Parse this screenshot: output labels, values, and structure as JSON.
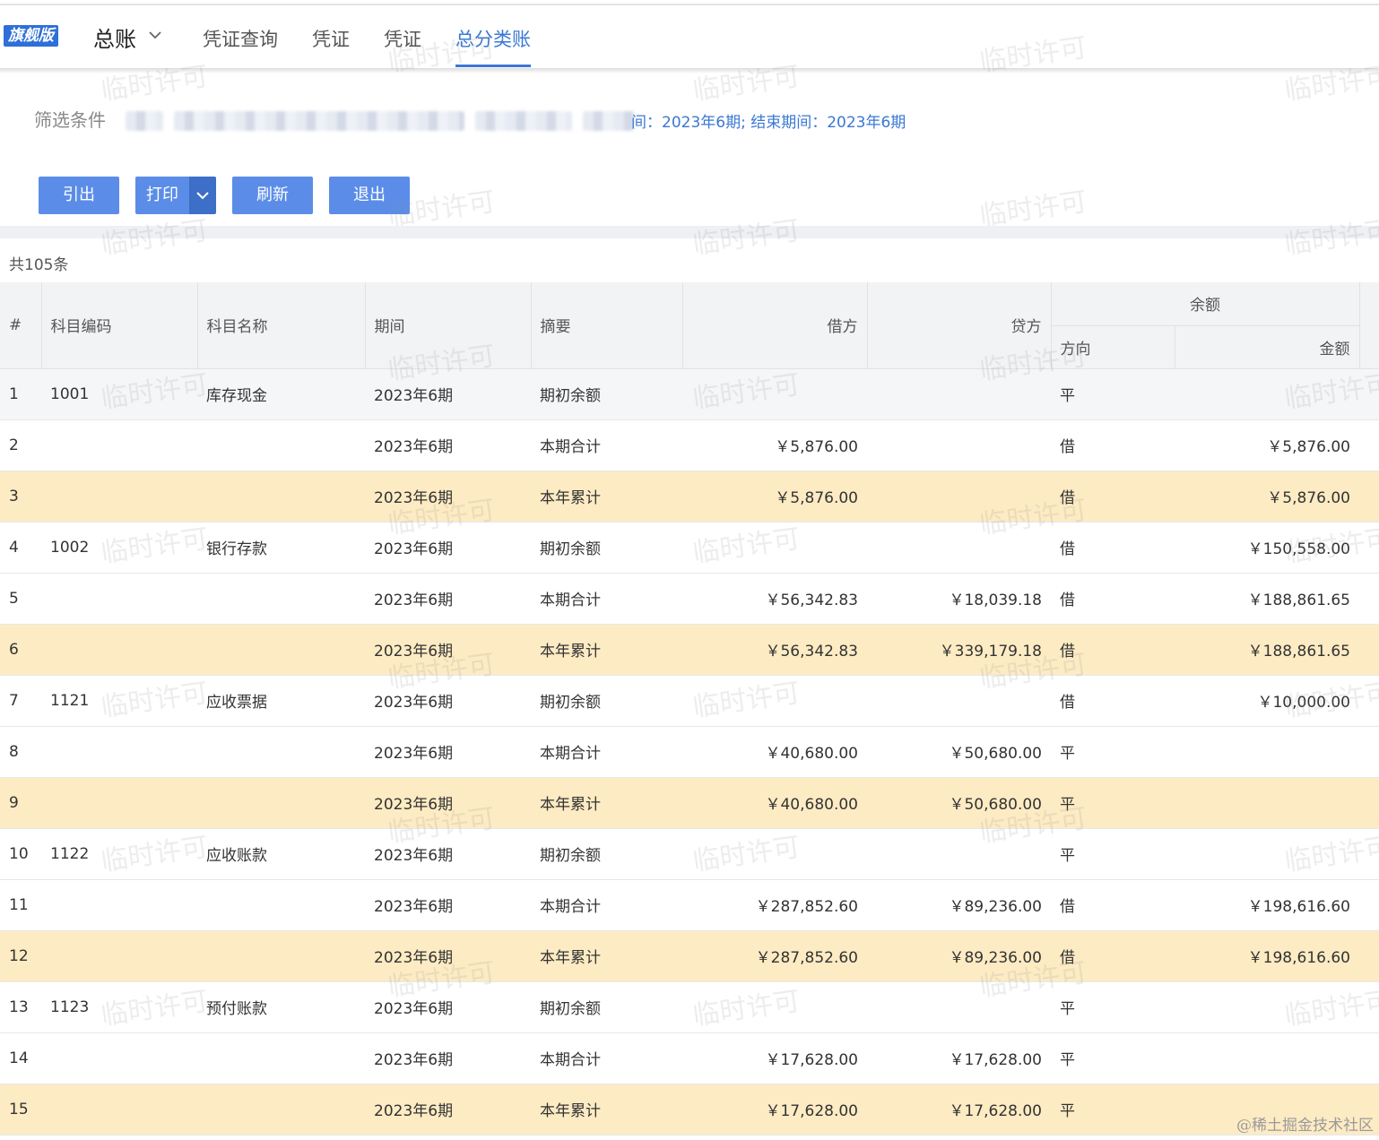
{
  "header": {
    "badge": "旗舰版",
    "module": "总账",
    "tabs": [
      {
        "label": "凭证查询",
        "active": false
      },
      {
        "label": "凭证",
        "active": false
      },
      {
        "label": "凭证",
        "active": false
      },
      {
        "label": "总分类账",
        "active": true
      }
    ]
  },
  "filter": {
    "label": "筛选条件",
    "text": "间：2023年6期; 结束期间：2023年6期"
  },
  "toolbar": {
    "export_label": "引出",
    "print_label": "打印",
    "refresh_label": "刷新",
    "exit_label": "退出"
  },
  "summary": {
    "count": "共105条"
  },
  "table": {
    "headers": {
      "index": "#",
      "code": "科目编码",
      "name": "科目名称",
      "period": "期间",
      "memo": "摘要",
      "debit": "借方",
      "credit": "贷方",
      "balance": "余额",
      "direction": "方向",
      "amount": "金额"
    },
    "rows": [
      {
        "no": "1",
        "code": "1001",
        "name": "库存现金",
        "period": "2023年6期",
        "memo": "期初余额",
        "debit": "",
        "credit": "",
        "dir": "平",
        "amount": "",
        "style": "first"
      },
      {
        "no": "2",
        "code": "",
        "name": "",
        "period": "2023年6期",
        "memo": "本期合计",
        "debit": "￥5,876.00",
        "credit": "",
        "dir": "借",
        "amount": "￥5,876.00",
        "style": ""
      },
      {
        "no": "3",
        "code": "",
        "name": "",
        "period": "2023年6期",
        "memo": "本年累计",
        "debit": "￥5,876.00",
        "credit": "",
        "dir": "借",
        "amount": "￥5,876.00",
        "style": "hl"
      },
      {
        "no": "4",
        "code": "1002",
        "name": "银行存款",
        "period": "2023年6期",
        "memo": "期初余额",
        "debit": "",
        "credit": "",
        "dir": "借",
        "amount": "￥150,558.00",
        "style": ""
      },
      {
        "no": "5",
        "code": "",
        "name": "",
        "period": "2023年6期",
        "memo": "本期合计",
        "debit": "￥56,342.83",
        "credit": "￥18,039.18",
        "dir": "借",
        "amount": "￥188,861.65",
        "style": ""
      },
      {
        "no": "6",
        "code": "",
        "name": "",
        "period": "2023年6期",
        "memo": "本年累计",
        "debit": "￥56,342.83",
        "credit": "￥339,179.18",
        "dir": "借",
        "amount": "￥188,861.65",
        "style": "hl"
      },
      {
        "no": "7",
        "code": "1121",
        "name": "应收票据",
        "period": "2023年6期",
        "memo": "期初余额",
        "debit": "",
        "credit": "",
        "dir": "借",
        "amount": "￥10,000.00",
        "style": ""
      },
      {
        "no": "8",
        "code": "",
        "name": "",
        "period": "2023年6期",
        "memo": "本期合计",
        "debit": "￥40,680.00",
        "credit": "￥50,680.00",
        "dir": "平",
        "amount": "",
        "style": ""
      },
      {
        "no": "9",
        "code": "",
        "name": "",
        "period": "2023年6期",
        "memo": "本年累计",
        "debit": "￥40,680.00",
        "credit": "￥50,680.00",
        "dir": "平",
        "amount": "",
        "style": "hl"
      },
      {
        "no": "10",
        "code": "1122",
        "name": "应收账款",
        "period": "2023年6期",
        "memo": "期初余额",
        "debit": "",
        "credit": "",
        "dir": "平",
        "amount": "",
        "style": ""
      },
      {
        "no": "11",
        "code": "",
        "name": "",
        "period": "2023年6期",
        "memo": "本期合计",
        "debit": "￥287,852.60",
        "credit": "￥89,236.00",
        "dir": "借",
        "amount": "￥198,616.60",
        "style": ""
      },
      {
        "no": "12",
        "code": "",
        "name": "",
        "period": "2023年6期",
        "memo": "本年累计",
        "debit": "￥287,852.60",
        "credit": "￥89,236.00",
        "dir": "借",
        "amount": "￥198,616.60",
        "style": "hl"
      },
      {
        "no": "13",
        "code": "1123",
        "name": "预付账款",
        "period": "2023年6期",
        "memo": "期初余额",
        "debit": "",
        "credit": "",
        "dir": "平",
        "amount": "",
        "style": ""
      },
      {
        "no": "14",
        "code": "",
        "name": "",
        "period": "2023年6期",
        "memo": "本期合计",
        "debit": "￥17,628.00",
        "credit": "￥17,628.00",
        "dir": "平",
        "amount": "",
        "style": ""
      },
      {
        "no": "15",
        "code": "",
        "name": "",
        "period": "2023年6期",
        "memo": "本年累计",
        "debit": "￥17,628.00",
        "credit": "￥17,628.00",
        "dir": "平",
        "amount": "",
        "style": "hl"
      }
    ]
  },
  "watermark": {
    "text": "临时许可"
  },
  "footer": {
    "credit": "@稀土掘金技术社区"
  },
  "colors": {
    "accent": "#3a78d4",
    "button": "#5b8de8",
    "highlight_row": "#fdebc3",
    "link": "#2b6fd0"
  },
  "icons": [
    "chevron-down-icon",
    "dropdown-caret-icon"
  ]
}
